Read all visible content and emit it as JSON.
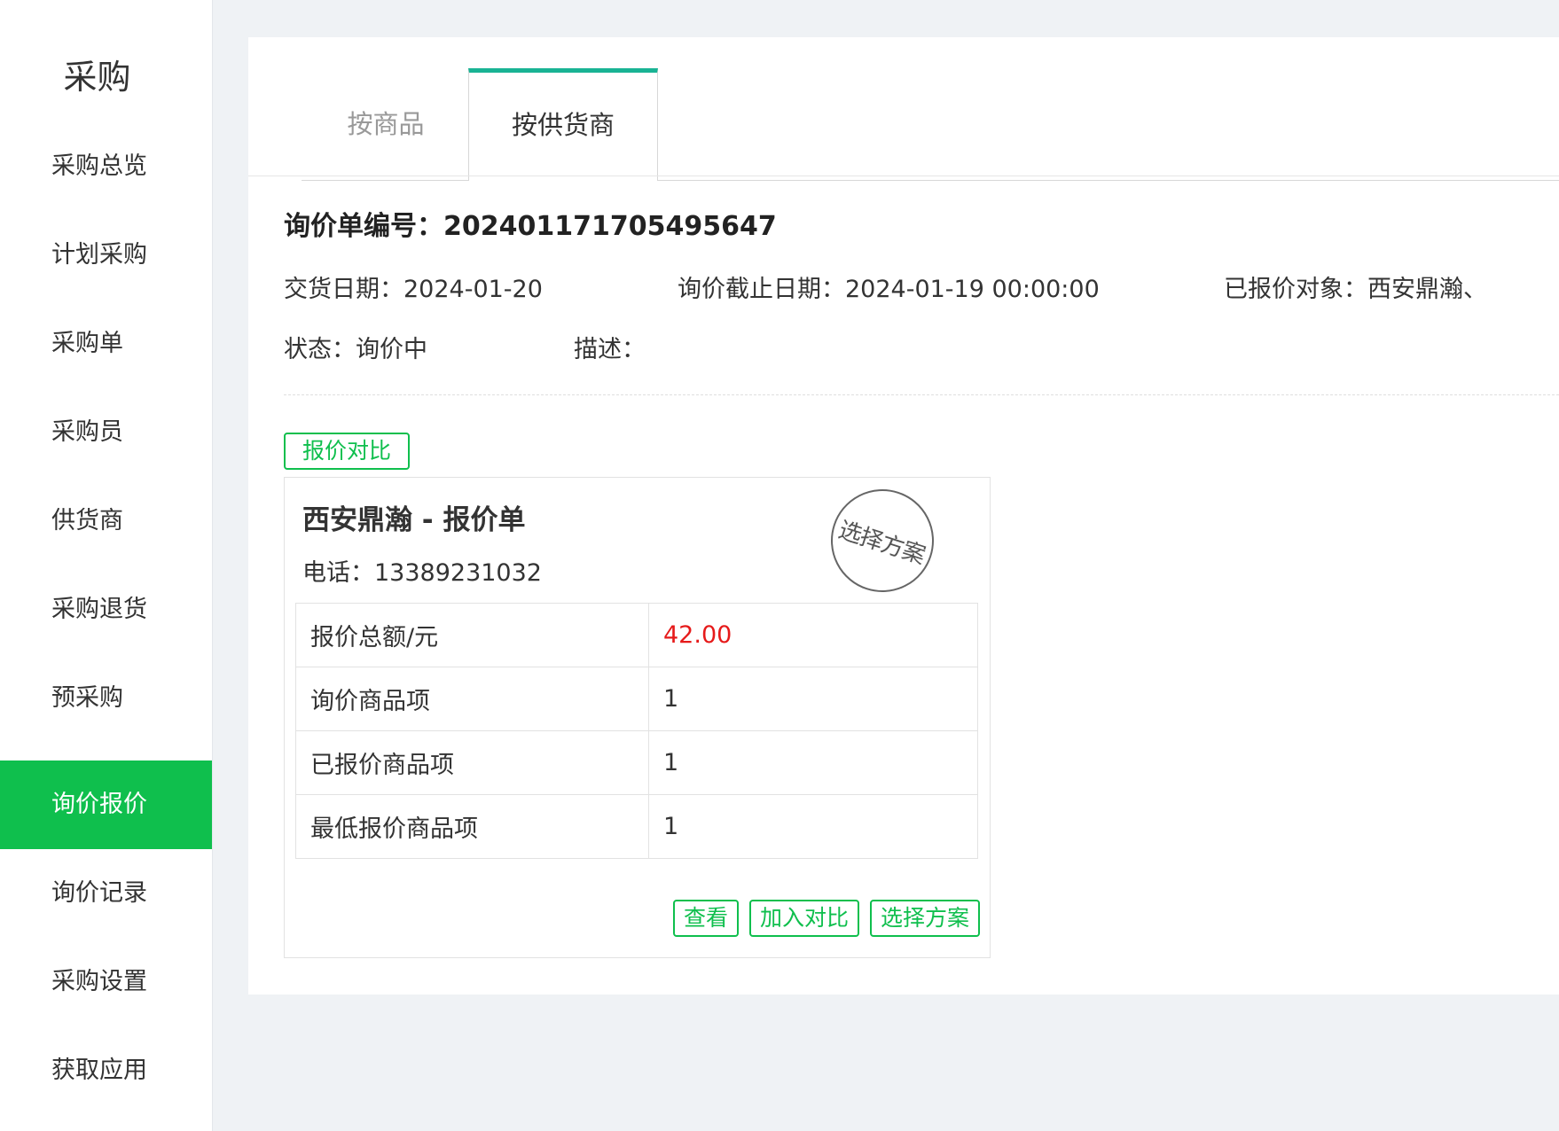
{
  "sidebar": {
    "title": "采购",
    "items": [
      {
        "label": "采购总览"
      },
      {
        "label": "计划采购"
      },
      {
        "label": "采购单"
      },
      {
        "label": "采购员"
      },
      {
        "label": "供货商"
      },
      {
        "label": "采购退货"
      },
      {
        "label": "预采购"
      },
      {
        "label": "询价报价",
        "active": true
      },
      {
        "label": "询价记录"
      },
      {
        "label": "采购设置"
      },
      {
        "label": "获取应用"
      }
    ]
  },
  "tabs": [
    {
      "label": "按商品",
      "active": false
    },
    {
      "label": "按供货商",
      "active": true
    }
  ],
  "inquiry": {
    "number_label": "询价单编号：",
    "number": "202401171705495647",
    "delivery_date_label": "交货日期：",
    "delivery_date": "2024-01-20",
    "deadline_label": "询价截止日期：",
    "deadline": "2024-01-19 00:00:00",
    "quoted_label": "已报价对象：",
    "quoted": "西安鼎瀚、",
    "status_label": "状态：",
    "status": "询价中",
    "desc_label": "描述：",
    "desc": ""
  },
  "compare_button": "报价对比",
  "card": {
    "title": "西安鼎瀚 - 报价单",
    "phone_label": "电话：",
    "phone": "13389231032",
    "stamp": "选择方案",
    "rows": [
      {
        "label": "报价总额/元",
        "value": "42.00"
      },
      {
        "label": "询价商品项",
        "value": "1"
      },
      {
        "label": "已报价商品项",
        "value": "1"
      },
      {
        "label": "最低报价商品项",
        "value": "1"
      }
    ],
    "actions": {
      "view": "查看",
      "add_compare": "加入对比",
      "select_plan": "选择方案"
    }
  },
  "colors": {
    "accent": "#0fbf4d",
    "tab_indicator": "#19b394",
    "price_red": "#e61a1a",
    "background": "#eff2f5"
  }
}
